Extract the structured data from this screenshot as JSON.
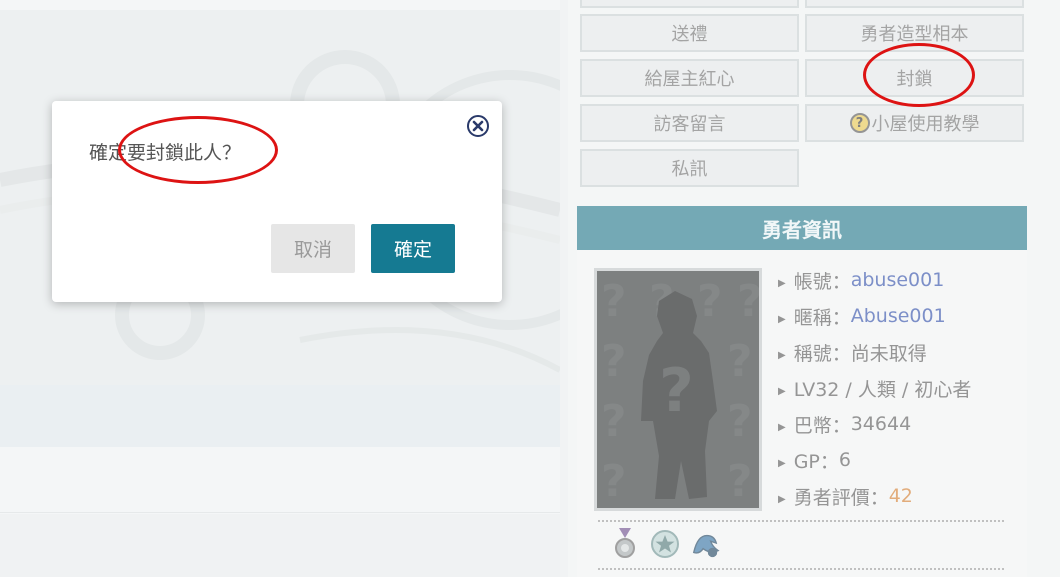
{
  "actions": {
    "top_row": [
      "",
      ""
    ],
    "gift": "送禮",
    "hero_album": "勇者造型相本",
    "give_heart": "給屋主紅心",
    "block": "封鎖",
    "guestbook": "訪客留言",
    "help_icon_glyph": "?",
    "help": "小屋使用教學",
    "private_message": "私訊"
  },
  "hero_info": {
    "header": "勇者資訊",
    "rows": [
      {
        "label": "帳號：",
        "value": "abuse001"
      },
      {
        "label": "暱稱：",
        "value": "Abuse001"
      },
      {
        "label": "稱號：",
        "value": "尚未取得"
      },
      {
        "label": "",
        "value": "LV32 / 人類 / 初心者"
      },
      {
        "label": "巴幣：",
        "value": "34644"
      },
      {
        "label": "GP：",
        "value": "6"
      },
      {
        "label": "勇者評價：",
        "value": "42"
      }
    ],
    "badges": [
      "medal-icon",
      "star-badge-icon",
      "dragon-badge-icon"
    ]
  },
  "dialog": {
    "message": "確定要封鎖此人？",
    "cancel_label": "取消",
    "confirm_label": "確定",
    "close_icon": "close-circle-icon"
  },
  "colors": {
    "accent": "#157a92",
    "header_bg": "#1f7488",
    "link_blue": "#2d4ba6",
    "rating_orange": "#d07a2a",
    "annotation_red": "#dd1313"
  }
}
